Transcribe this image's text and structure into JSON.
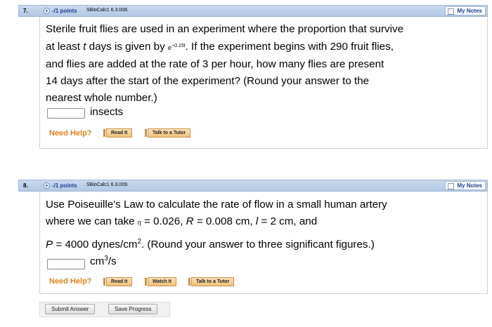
{
  "q7": {
    "number": "7.",
    "points": "-/1 points",
    "assignment": "SBioCalc1 6.3.008.",
    "my_notes": "My Notes",
    "text_line1": "Sterile fruit flies are used in an experiment where the proportion that survive",
    "text_line2_a": "at least ",
    "text_line2_t": "t",
    "text_line2_b": " days is given by ",
    "text_line2_exp_base": "e",
    "text_line2_exp": "−0.15t",
    "text_line2_c": ". If the experiment begins with 290 fruit flies,",
    "text_line3": "and flies are added at the rate of 3 per hour, how many flies are present",
    "text_line4": "14 days after the start of the experiment? (Round your answer to the",
    "text_line5": "nearest whole number.)",
    "answer_value": "",
    "unit": "insects",
    "need_help": "Need Help?",
    "buttons": [
      "Read It",
      "Talk to a Tutor"
    ]
  },
  "q8": {
    "number": "8.",
    "points": "-/1 points",
    "assignment": "SBioCalc1 6.3.009.",
    "my_notes": "My Notes",
    "text_line1": "Use Poiseuille's Law to calculate the rate of flow in a small human artery",
    "text_line2_a": "where we can take ",
    "eta": "η",
    "text_line2_b": " = 0.026, ",
    "R": "R",
    "text_line2_c": " = 0.008 cm, ",
    "l": "l",
    "text_line2_d": " = 2 cm, and",
    "P": "P",
    "text_line3_a": " = 4000 dynes/cm",
    "text_line3_sup": "2",
    "text_line3_b": ". (Round your answer to three significant figures.)",
    "answer_value": "",
    "unit_base": "cm",
    "unit_sup": "3",
    "unit_tail": "/s",
    "need_help": "Need Help?",
    "buttons": [
      "Read It",
      "Watch It",
      "Talk to a Tutor"
    ]
  },
  "footer": {
    "submit": "Submit Answer",
    "save": "Save Progress"
  }
}
